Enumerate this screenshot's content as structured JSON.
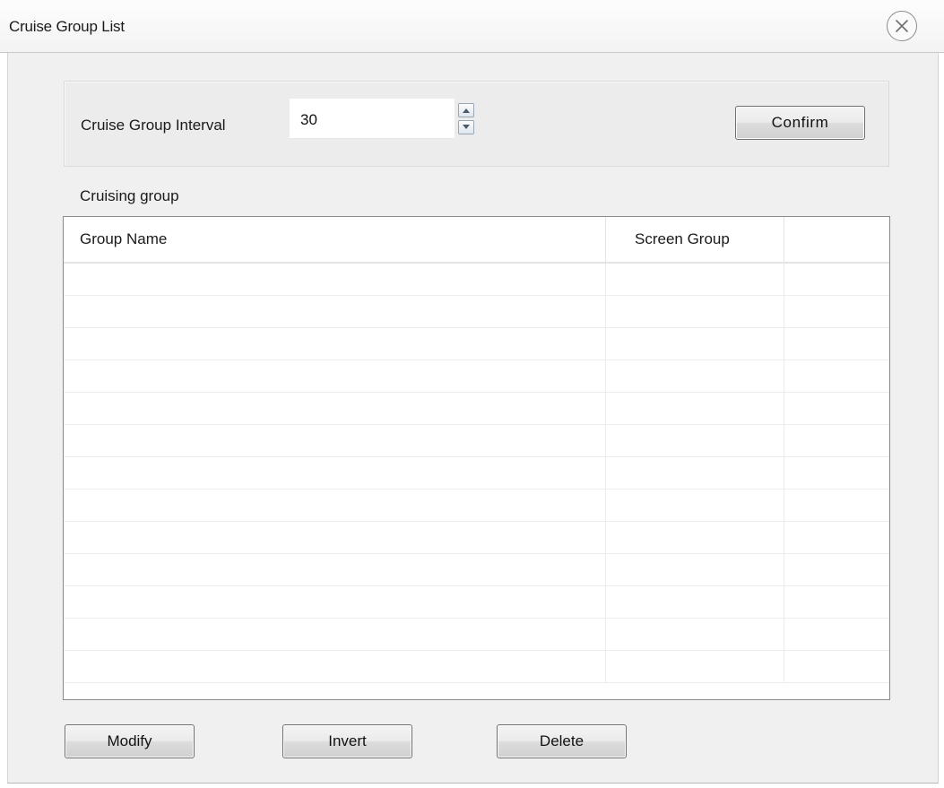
{
  "window": {
    "title": "Cruise Group List",
    "close_icon": "close-circle-icon"
  },
  "interval": {
    "label": "Cruise Group Interval",
    "value": "30",
    "spin_up_icon": "caret-up-icon",
    "spin_down_icon": "caret-down-icon",
    "confirm_label": "Confirm"
  },
  "group_list": {
    "section_label": "Cruising group",
    "columns": [
      "Group Name",
      "Screen Group",
      ""
    ],
    "rows": [],
    "empty_row_count": 13
  },
  "actions": {
    "modify_label": "Modify",
    "invert_label": "Invert",
    "delete_label": "Delete"
  }
}
